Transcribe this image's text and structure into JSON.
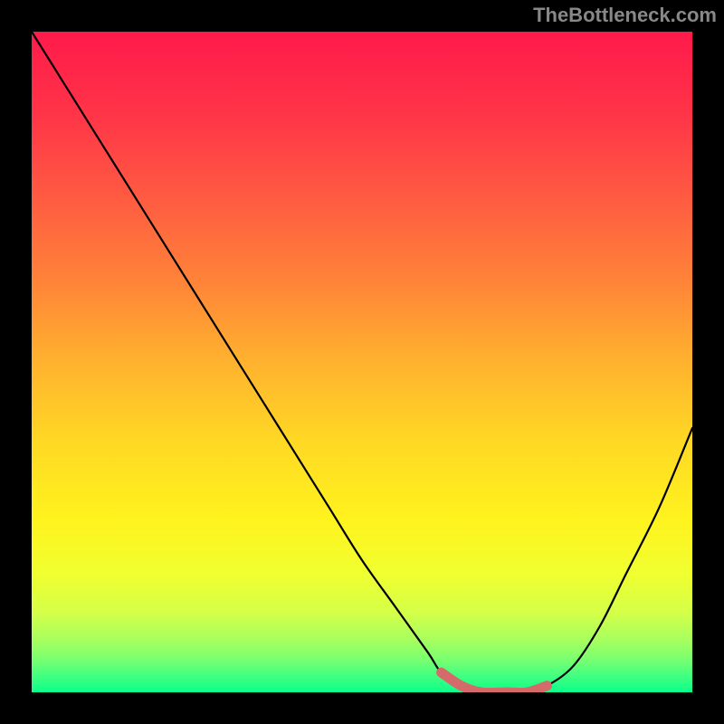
{
  "watermark": "TheBottleneck.com",
  "chart_data": {
    "type": "line",
    "title": "",
    "xlabel": "",
    "ylabel": "",
    "xlim": [
      0,
      100
    ],
    "ylim": [
      0,
      100
    ],
    "series": [
      {
        "name": "bottleneck-curve",
        "x": [
          0,
          5,
          10,
          15,
          20,
          25,
          30,
          35,
          40,
          45,
          50,
          55,
          60,
          62,
          65,
          68,
          72,
          75,
          78,
          82,
          86,
          90,
          95,
          100
        ],
        "y": [
          100,
          92,
          84,
          76,
          68,
          60,
          52,
          44,
          36,
          28,
          20,
          13,
          6,
          3,
          1,
          0,
          0,
          0,
          1,
          4,
          10,
          18,
          28,
          40
        ]
      },
      {
        "name": "optimal-zone-highlight",
        "x": [
          62,
          65,
          68,
          72,
          75,
          78
        ],
        "y": [
          3,
          1,
          0,
          0,
          0,
          1
        ]
      }
    ],
    "gradient_stops": [
      {
        "offset": 0,
        "color": "#ff1a4a"
      },
      {
        "offset": 12,
        "color": "#ff3348"
      },
      {
        "offset": 25,
        "color": "#ff5a42"
      },
      {
        "offset": 38,
        "color": "#ff8438"
      },
      {
        "offset": 50,
        "color": "#ffb22e"
      },
      {
        "offset": 62,
        "color": "#ffd824"
      },
      {
        "offset": 74,
        "color": "#fff31e"
      },
      {
        "offset": 82,
        "color": "#f0ff30"
      },
      {
        "offset": 88,
        "color": "#d4ff48"
      },
      {
        "offset": 92,
        "color": "#a8ff5e"
      },
      {
        "offset": 95,
        "color": "#7aff70"
      },
      {
        "offset": 97,
        "color": "#4cff7e"
      },
      {
        "offset": 99,
        "color": "#22ff86"
      },
      {
        "offset": 100,
        "color": "#08ff8c"
      }
    ]
  }
}
